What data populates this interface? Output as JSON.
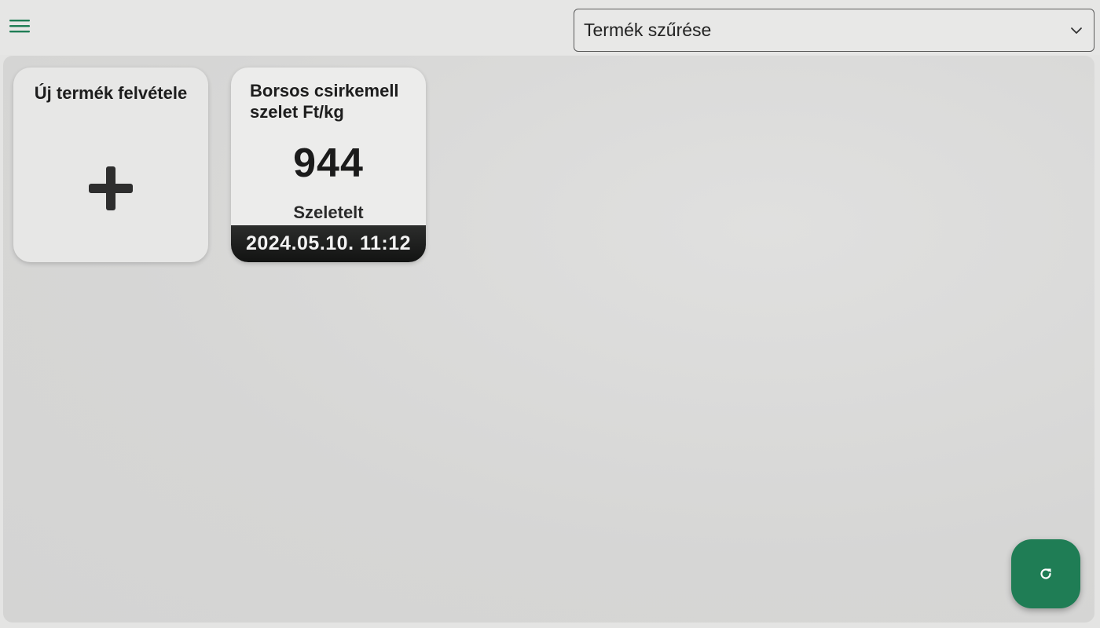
{
  "header": {
    "menu_icon": "hamburger-menu-icon",
    "filter": {
      "placeholder": "Termék szűrése",
      "chevron_icon": "chevron-down-icon"
    }
  },
  "new_product_card": {
    "title": "Új termék felvétele",
    "icon": "plus-icon"
  },
  "products": [
    {
      "name": "Borsos csirkemell szelet Ft/kg",
      "price": "944",
      "type": "Szeletelt",
      "date": "2024.05.10. 11:12"
    }
  ],
  "fab": {
    "icon": "refresh-icon"
  },
  "colors": {
    "accent": "#1f7d55",
    "background": "#e4e4e3",
    "card": "#e7e7e6",
    "date_bar": "#1a1b1a"
  }
}
